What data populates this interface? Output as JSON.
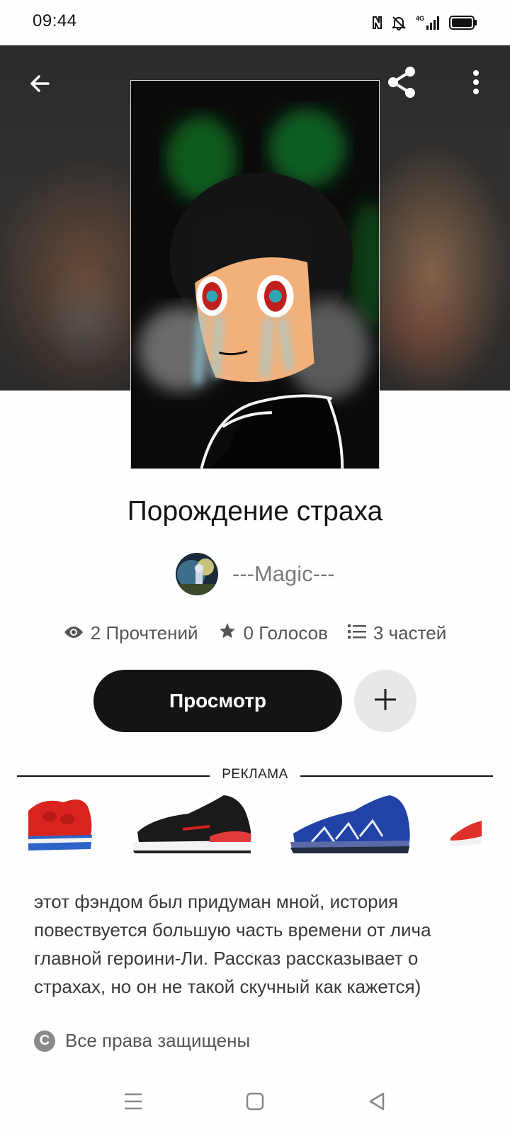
{
  "status_bar": {
    "time": "09:44",
    "network": "4G",
    "icons": [
      "nfc-icon",
      "bell-muted-icon",
      "signal-4g-icon",
      "battery-icon"
    ]
  },
  "hero": {
    "back_icon": "arrow-left-icon",
    "share_icon": "share-icon",
    "more_icon": "more-vertical-icon"
  },
  "story": {
    "title": "Порождение страха",
    "author": "---Magic---",
    "stats": {
      "reads": "2 Прочтений",
      "votes": "0 Голосов",
      "parts": "3 частей"
    },
    "read_button": "Просмотр",
    "add_icon": "plus-icon",
    "description": "этот фэндом был придуман мной, история повествуется большую часть времени от лича главной героини-Ли. Рассказ рассказывает о страхах, но он не такой скучный как кажется)",
    "copyright": "Все права защищены",
    "copyright_icon": "copyright-icon"
  },
  "ad": {
    "label": "РЕКЛАМА",
    "items": [
      "red-sneaker",
      "black-red-sneaker",
      "blue-sneaker",
      "red-sneaker-partial"
    ]
  },
  "nav_bar": {
    "icons": [
      "menu-icon",
      "home-square-icon",
      "back-triangle-icon"
    ]
  },
  "colors": {
    "primary_button": "#141414",
    "add_button_bg": "#e8e7ea",
    "text_muted": "#7a7a7a"
  }
}
